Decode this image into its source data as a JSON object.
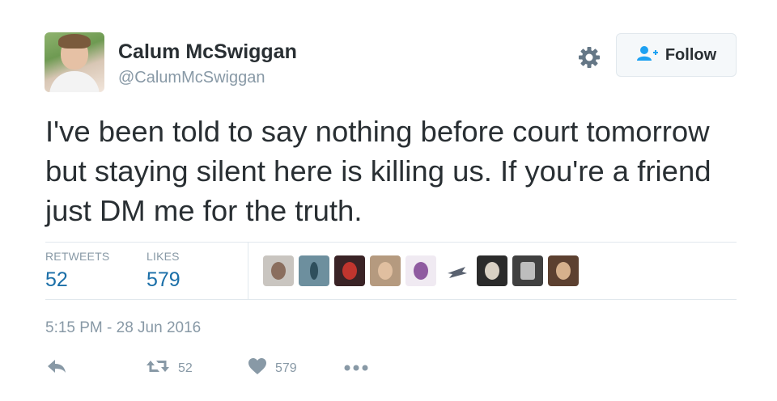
{
  "author": {
    "name": "Calum McSwiggan",
    "handle": "@CalumMcSwiggan"
  },
  "header": {
    "settings_icon": "gear-icon",
    "follow_label": "Follow",
    "follow_icon": "add-user-icon"
  },
  "tweet": {
    "text": "I've been told to say nothing before court tomorrow but staying silent here is killing us. If you're a friend just DM me for the truth.",
    "timestamp": "5:15 PM - 28 Jun 2016"
  },
  "stats": {
    "retweets_label": "RETWEETS",
    "retweets_count": "52",
    "likes_label": "LIKES",
    "likes_count": "579"
  },
  "actions": {
    "reply_icon": "reply-icon",
    "retweet_icon": "retweet-icon",
    "retweet_count": "52",
    "like_icon": "heart-icon",
    "like_count": "579",
    "more_icon": "more-dots-icon"
  },
  "colors": {
    "text": "#292f33",
    "muted": "#8899a6",
    "count_blue": "#1b6fa8",
    "follow_icon": "#1da1f2",
    "divider": "#e1e8ed"
  }
}
